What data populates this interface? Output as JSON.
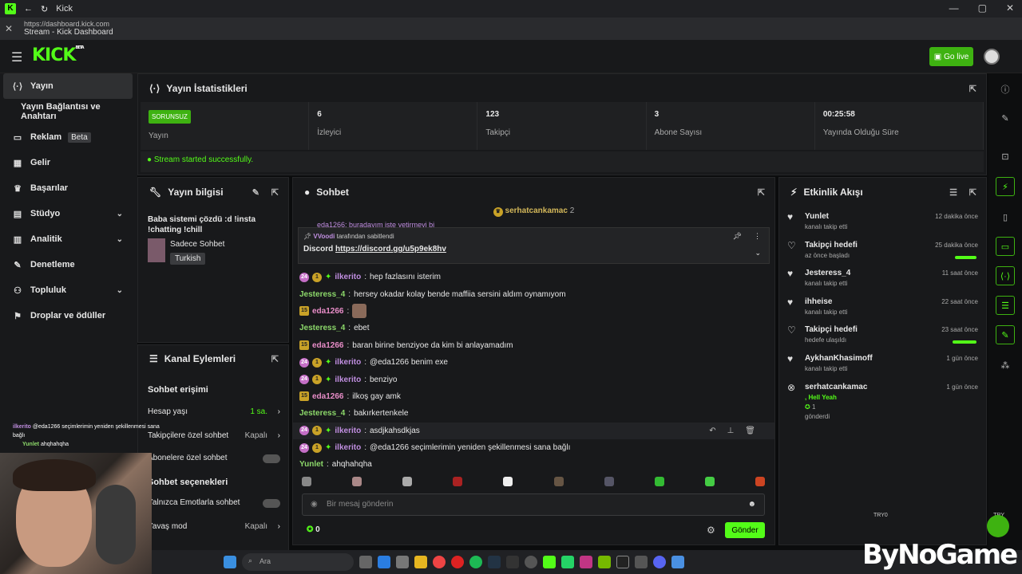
{
  "window": {
    "title": "Kick"
  },
  "browser": {
    "url": "https://dashboard.kick.com",
    "tab_title": "Stream - Kick Dashboard"
  },
  "header": {
    "logo": "KICK",
    "logo_badge": "BETA",
    "go_live": "Go live"
  },
  "sidebar": {
    "items": [
      {
        "label": "Yayın",
        "icon": "broadcast-icon"
      },
      {
        "label": "Yayın Bağlantısı ve Anahtarı",
        "icon": ""
      },
      {
        "label": "Reklam",
        "icon": "ad-icon",
        "badge": "Beta"
      },
      {
        "label": "Gelir",
        "icon": "chart-icon"
      },
      {
        "label": "Başarılar",
        "icon": "trophy-icon"
      },
      {
        "label": "Stüdyo",
        "icon": "studio-icon"
      },
      {
        "label": "Analitik",
        "icon": "analytics-icon"
      },
      {
        "label": "Denetleme",
        "icon": "moderation-icon"
      },
      {
        "label": "Topluluk",
        "icon": "community-icon"
      },
      {
        "label": "Droplar ve ödüller",
        "icon": "gift-icon"
      }
    ]
  },
  "stats": {
    "title": "Yayın İstatistikleri",
    "status_badge": "SORUNSUZ",
    "cells": [
      {
        "value": "",
        "label": "Yayın"
      },
      {
        "value": "6",
        "label": "İzleyici"
      },
      {
        "value": "123",
        "label": "Takipçi"
      },
      {
        "value": "3",
        "label": "Abone Sayısı"
      },
      {
        "value": "00:25:58",
        "label": "Yayında Olduğu Süre"
      }
    ],
    "ok_message": "Stream started successfully."
  },
  "stream_info": {
    "title": "Yayın bilgisi",
    "stream_title": "Baba sistemi çözdü :d !insta !chatting !chill",
    "category": "Sadece Sohbet",
    "tag": "Turkish"
  },
  "channel_actions": {
    "title": "Kanal Eylemleri",
    "section1": "Sohbet erişimi",
    "rows": [
      {
        "label": "Hesap yaşı",
        "value": "1 sa."
      },
      {
        "label": "Takipçilere özel sohbet",
        "value": "Kapalı"
      },
      {
        "label": "Abonelere özel sohbet",
        "value": ""
      }
    ],
    "section2": "Sohbet seçenekleri",
    "rows2": [
      {
        "label": "Yalnızca Emotlarla sohbet",
        "value": ""
      },
      {
        "label": "Yavaş mod",
        "value": "Kapalı"
      }
    ]
  },
  "chat": {
    "title": "Sohbet",
    "top_user": "serhatcankamac",
    "top_count": "2",
    "partial": "eda1266: buradayım işte yetirmeyi bi",
    "pinned": {
      "by": "VVoodi",
      "by_text": "tarafından sabitlendi",
      "label": "Discord",
      "link": "https://discord.gg/u5p9ek8hv"
    },
    "messages": [
      {
        "user": "ilkerito",
        "text": "hep fazlasını isterim",
        "badges": "24"
      },
      {
        "user": "Jesteress_4",
        "text": "hersey okadar kolay bende maffiia sersini aldım oynamıyom",
        "badges": ""
      },
      {
        "user": "eda1266",
        "text": "",
        "badges": "15"
      },
      {
        "user": "Jesteress_4",
        "text": "ebet",
        "badges": ""
      },
      {
        "user": "eda1266",
        "text": "baran birine benziyoe da kim bi anlayamadım",
        "badges": "15"
      },
      {
        "user": "ilkerito",
        "text": "@eda1266 benim exe",
        "badges": "24"
      },
      {
        "user": "ilkerito",
        "text": "benziyo",
        "badges": "24"
      },
      {
        "user": "eda1266",
        "text": "ilkoş gay amk",
        "badges": "15"
      },
      {
        "user": "Jesteress_4",
        "text": "bakırkertenkele",
        "badges": ""
      },
      {
        "user": "ilkerito",
        "text": "asdjkahsdkjas",
        "badges": "24"
      },
      {
        "user": "ilkerito",
        "text": "@eda1266 seçimlerimin yeniden şekillenmesi sana bağlı",
        "badges": "24"
      },
      {
        "user": "Yunlet",
        "text": "ahqhahqha",
        "badges": ""
      }
    ],
    "placeholder": "Bir mesaj gönderin",
    "points": "0",
    "send": "Gönder"
  },
  "feed": {
    "title": "Etkinlik Akışı",
    "items": [
      {
        "name": "Yunlet",
        "sub": "kanalı takip etti",
        "time": "12 dakika önce"
      },
      {
        "name": "Takipçi hedefi",
        "sub": "az önce başladı",
        "time": "25 dakika önce",
        "bar": 0.9
      },
      {
        "name": "Jesteress_4",
        "sub": "kanalı takip etti",
        "time": "11 saat önce"
      },
      {
        "name": "ihheise",
        "sub": "kanalı takip etti",
        "time": "22 saat önce"
      },
      {
        "name": "Takipçi hedefi",
        "sub": "hedefe ulaşıldı",
        "time": "23 saat önce",
        "bar": 1
      },
      {
        "name": "AykhanKhasimoff",
        "sub": "kanalı takip etti",
        "time": "1 gün önce"
      },
      {
        "name": "serhatcankamac",
        "sub": ", Hell Yeah",
        "sub2": "1",
        "sub3": "gönderdi",
        "time": "1 gün önce"
      }
    ]
  },
  "overlay": {
    "lines": [
      {
        "user": "ilkerito",
        "text": "@eda1266 seçimlerimin yeniden şekillenmesi sana bağlı"
      },
      {
        "user": "Yunlet",
        "text": "ahqhahqha"
      }
    ],
    "brand": "ByNoGame",
    "mini1": "TRY0",
    "mini2": "TRY"
  },
  "taskbar": {
    "search": "Ara"
  }
}
